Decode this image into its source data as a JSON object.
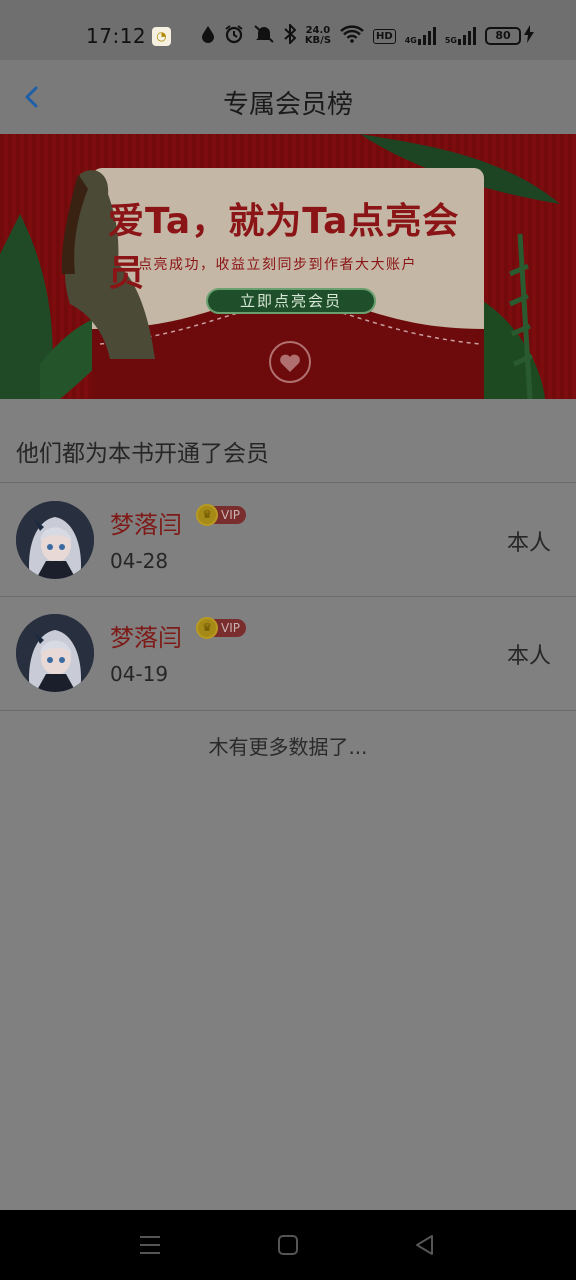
{
  "status_bar": {
    "time": "17:12",
    "speed_value": "24.0",
    "speed_unit": "KB/S",
    "hd_label": "HD",
    "net1": "4G",
    "net2": "5G",
    "battery": "80",
    "icons": [
      "water-drop-icon",
      "alarm-icon",
      "mute-icon",
      "bluetooth-icon",
      "wifi-icon",
      "signal-icon",
      "charging-icon"
    ]
  },
  "header": {
    "title": "专属会员榜",
    "back_icon": "chevron-left-icon",
    "accent": "#1f73c9"
  },
  "banner": {
    "title": "爱Ta，就为Ta点亮会员",
    "subtitle": "点亮成功，收益立刻同步到作者大大账户",
    "cta": "立即点亮会员"
  },
  "section": {
    "title": "他们都为本书开通了会员"
  },
  "members": [
    {
      "name": "梦落闫",
      "badge": "VIP",
      "date": "04-28",
      "tag": "本人"
    },
    {
      "name": "梦落闫",
      "badge": "VIP",
      "date": "04-19",
      "tag": "本人"
    }
  ],
  "footer": {
    "no_more": "木有更多数据了..."
  },
  "system_nav": [
    "menu-icon",
    "home-square-icon",
    "back-triangle-icon"
  ]
}
